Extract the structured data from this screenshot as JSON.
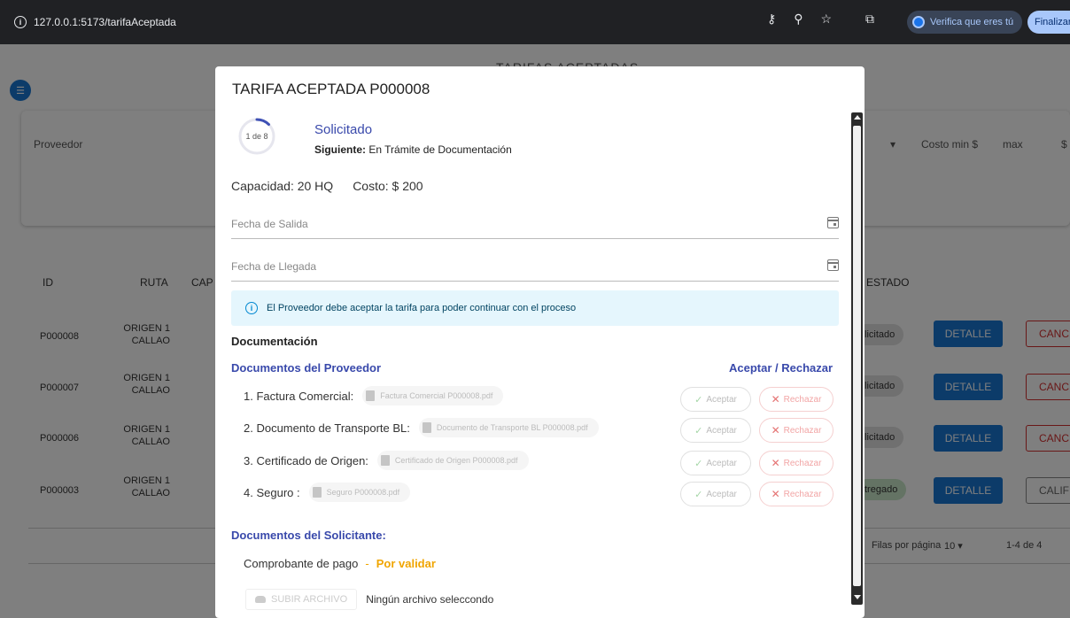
{
  "browser": {
    "url": "127.0.0.1:5173/tarifaAceptada",
    "verifica_label": "Verifica que eres tú",
    "finalizar_label": "Finalizar"
  },
  "background": {
    "title": "TARIFAS ACEPTADAS",
    "filters": {
      "proveedor_label": "Proveedor",
      "costo_min_label": "Costo min $",
      "max_label": "max",
      "dollar": "$"
    },
    "table": {
      "headers": {
        "id": "ID",
        "ruta": "RUTA",
        "cap": "CAP",
        "estado": "ESTADO"
      },
      "rows": [
        {
          "id": "P000008",
          "route_l1": "ORIGEN 1",
          "route_l2": "CALLAO",
          "status": "licitado",
          "detail": "DETALLE",
          "action": "CANC"
        },
        {
          "id": "P000007",
          "route_l1": "ORIGEN 1",
          "route_l2": "CALLAO",
          "status": "licitado",
          "detail": "DETALLE",
          "action": "CANC"
        },
        {
          "id": "P000006",
          "route_l1": "ORIGEN 1",
          "route_l2": "CALLAO",
          "status": "licitado",
          "detail": "DETALLE",
          "action": "CANC"
        },
        {
          "id": "P000003",
          "route_l1": "ORIGEN 1",
          "route_l2": "CALLAO",
          "status": "tregado",
          "detail": "DETALLE",
          "action": "CALIF"
        }
      ],
      "rows_per_page_label": "Filas por página",
      "rows_per_page_value": "10",
      "range": "1-4 de 4"
    }
  },
  "modal": {
    "title": "TARIFA ACEPTADA P000008",
    "progress": {
      "text": "1 de 8",
      "fraction": 0.125
    },
    "current_stage": "Solicitado",
    "next_label": "Siguiente:",
    "next_stage": "En Trámite de Documentación",
    "capacity": "Capacidad: 20 HQ",
    "cost": "Costo: $ 200",
    "fecha_salida": "Fecha de Salida",
    "fecha_llegada": "Fecha de Llegada",
    "alert": "El Proveedor debe aceptar la tarifa para poder continuar con el proceso",
    "documentacion": "Documentación",
    "proveedor_docs_title": "Documentos del Proveedor",
    "aceptar_rechazar": "Aceptar / Rechazar",
    "accept_label": "Aceptar",
    "reject_label": "Rechazar",
    "documents": [
      {
        "label": "1. Factura Comercial:",
        "file": "Factura Comercial P000008.pdf"
      },
      {
        "label": "2. Documento de Transporte BL:",
        "file": "Documento de Transporte BL P000008.pdf"
      },
      {
        "label": "3. Certificado de Origen:",
        "file": "Certificado de Origen P000008.pdf"
      },
      {
        "label": "4. Seguro :",
        "file": "Seguro P000008.pdf"
      }
    ],
    "solicitante_docs_title": "Documentos del Solicitante:",
    "comprobante_label": "Comprobante de pago",
    "comprobante_sep": "-",
    "comprobante_status": "Por validar",
    "upload_label": "SUBIR ARCHIVO",
    "upload_hint": "Ningún archivo seleccondo"
  }
}
